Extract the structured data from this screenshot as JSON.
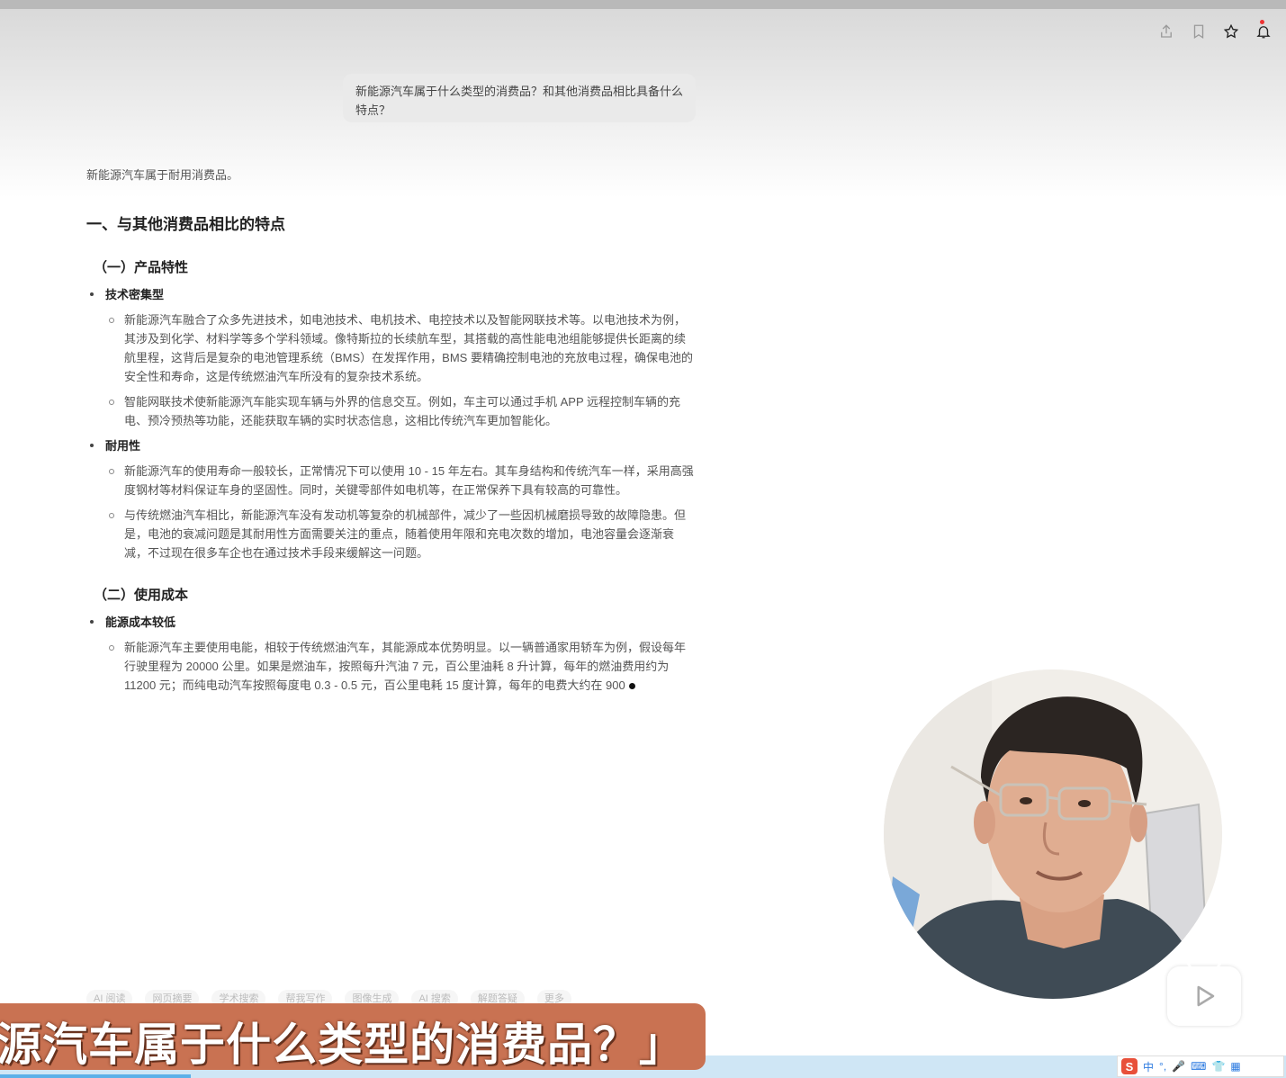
{
  "question": "新能源汽车属于什么类型的消费品？和其他消费品相比具备什么特点？",
  "answer": {
    "intro": "新能源汽车属于耐用消费品。",
    "h1": "一、与其他消费品相比的特点",
    "section1": {
      "title": "（一）产品特性",
      "bullet1": {
        "label": "技术密集型",
        "p1": "新能源汽车融合了众多先进技术，如电池技术、电机技术、电控技术以及智能网联技术等。以电池技术为例，其涉及到化学、材料学等多个学科领域。像特斯拉的长续航车型，其搭载的高性能电池组能够提供长距离的续航里程，这背后是复杂的电池管理系统（BMS）在发挥作用，BMS 要精确控制电池的充放电过程，确保电池的安全性和寿命，这是传统燃油汽车所没有的复杂技术系统。",
        "p2": "智能网联技术使新能源汽车能实现车辆与外界的信息交互。例如，车主可以通过手机 APP 远程控制车辆的充电、预冷预热等功能，还能获取车辆的实时状态信息，这相比传统汽车更加智能化。"
      },
      "bullet2": {
        "label": "耐用性",
        "p1": "新能源汽车的使用寿命一般较长，正常情况下可以使用 10 - 15 年左右。其车身结构和传统汽车一样，采用高强度钢材等材料保证车身的坚固性。同时，关键零部件如电机等，在正常保养下具有较高的可靠性。",
        "p2": "与传统燃油汽车相比，新能源汽车没有发动机等复杂的机械部件，减少了一些因机械磨损导致的故障隐患。但是，电池的衰减问题是其耐用性方面需要关注的重点，随着使用年限和充电次数的增加，电池容量会逐渐衰减，不过现在很多车企也在通过技术手段来缓解这一问题。"
      }
    },
    "section2": {
      "title": "（二）使用成本",
      "bullet1": {
        "label": "能源成本较低",
        "p1": "新能源汽车主要使用电能，相较于传统燃油汽车，其能源成本优势明显。以一辆普通家用轿车为例，假设每年行驶里程为 20000 公里。如果是燃油车，按照每升汽油 7 元，百公里油耗 8 升计算，每年的燃油费用约为 11200 元；而纯电动汽车按照每度电 0.3 - 0.5 元，百公里电耗 15 度计算，每年的电费大约在 900"
      }
    }
  },
  "chips": [
    "AI 阅读",
    "网页摘要",
    "学术搜索",
    "帮我写作",
    "图像生成",
    "AI 搜索",
    "解题答疑",
    "更多"
  ],
  "subtitle": "源汽车属于什么类型的消费品？」",
  "ime": {
    "logo": "S",
    "mode": "中"
  },
  "toolbar_icons": [
    "share-icon",
    "bookmark-icon",
    "star-icon",
    "bell-icon"
  ],
  "colors": {
    "banner": "#c97252",
    "progress": "#5bb0e8",
    "question_bg": "#eaeaea"
  }
}
